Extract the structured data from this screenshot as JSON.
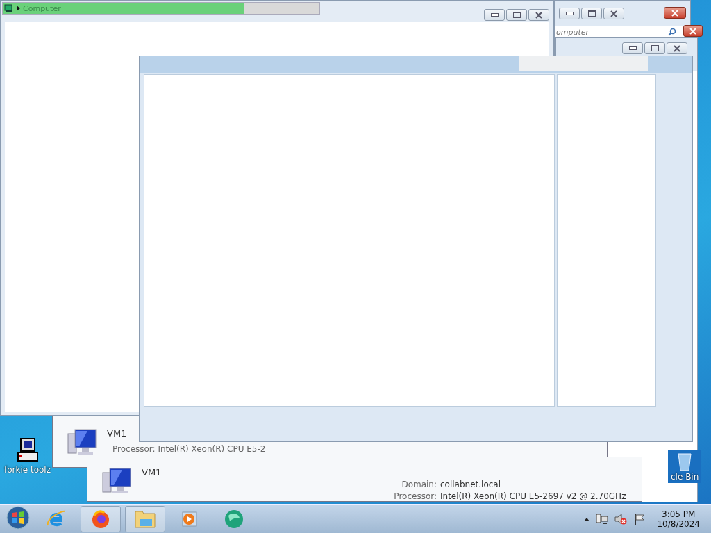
{
  "back_window": {
    "address_text": "omputer"
  },
  "main_window": {
    "address_text": "Computer",
    "progress": {
      "level": 0.76
    }
  },
  "vm_panels": [
    {
      "name": "VM1",
      "details": [
        {
          "label": "Processor: Intel(R) Xeon(R) CPU E5-2"
        }
      ]
    },
    {
      "name": "VM1",
      "details": [
        {
          "label": "Domain:",
          "value": "collabnet.local"
        },
        {
          "label": "Processor:",
          "value": "Intel(R) Xeon(R) CPU E5-2697 v2 @ 2.70GHz"
        }
      ]
    }
  ],
  "desktop_icons": [
    {
      "kind": "computer",
      "label": "forkie toolz"
    },
    {
      "kind": "bin",
      "label": "cle Bin"
    }
  ],
  "taskbar": {
    "buttons": [
      {
        "kind": "browser-e",
        "selected": false
      },
      {
        "kind": "fox",
        "selected": true
      },
      {
        "kind": "folder",
        "selected": true
      },
      {
        "kind": "media",
        "selected": false
      },
      {
        "kind": "globe",
        "selected": false
      }
    ],
    "clock": {
      "time": "3:05 PM",
      "date": "10/8/2024"
    }
  }
}
